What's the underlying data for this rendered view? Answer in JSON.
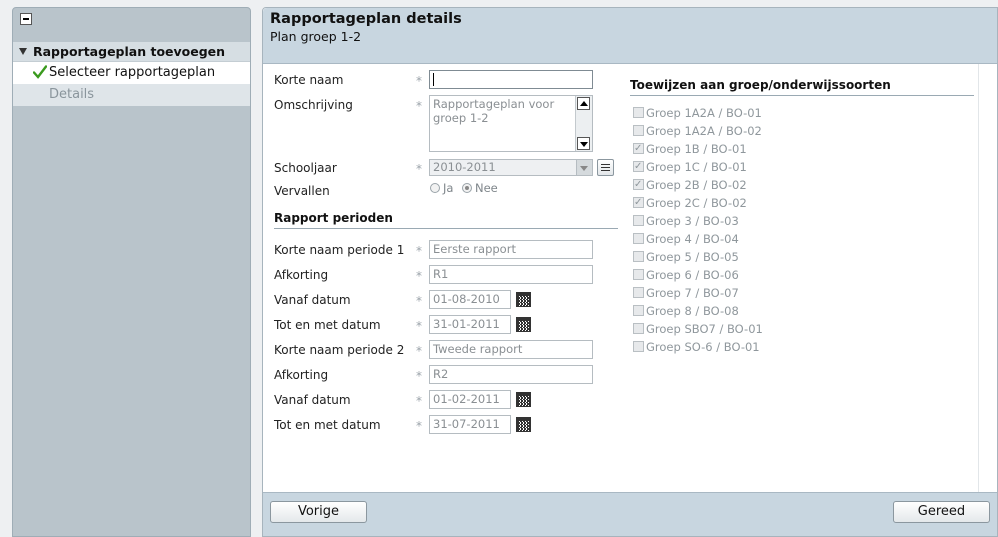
{
  "left_panel": {
    "group_title": "Rapportageplan toevoegen",
    "steps": [
      {
        "label": "Selecteer rapportageplan",
        "state": "done"
      },
      {
        "label": "Details",
        "state": "disabled"
      }
    ]
  },
  "header": {
    "title": "Rapportageplan details",
    "subtitle": "Plan groep 1-2"
  },
  "form": {
    "required_mark": "*",
    "korte_naam": {
      "label": "Korte naam",
      "value": ""
    },
    "omschrijving": {
      "label": "Omschrijving",
      "value": "Rapportageplan voor groep 1-2"
    },
    "schooljaar": {
      "label": "Schooljaar",
      "value": "2010-2011"
    },
    "vervallen": {
      "label": "Vervallen",
      "options": [
        "Ja",
        "Nee"
      ],
      "selected": "Nee"
    }
  },
  "periods": {
    "section_title": "Rapport perioden",
    "items": [
      {
        "name_label": "Korte naam periode 1",
        "name_value": "Eerste rapport",
        "abbr_label": "Afkorting",
        "abbr_value": "R1",
        "from_label": "Vanaf datum",
        "from_value": "01-08-2010",
        "to_label": "Tot en met datum",
        "to_value": "31-01-2011"
      },
      {
        "name_label": "Korte naam periode 2",
        "name_value": "Tweede rapport",
        "abbr_label": "Afkorting",
        "abbr_value": "R2",
        "from_label": "Vanaf datum",
        "from_value": "01-02-2011",
        "to_label": "Tot en met datum",
        "to_value": "31-07-2011"
      }
    ]
  },
  "groups": {
    "section_title": "Toewijzen aan groep/onderwijssoorten",
    "items": [
      {
        "label": "Groep 1A2A / BO-01",
        "checked": false
      },
      {
        "label": "Groep 1A2A / BO-02",
        "checked": false
      },
      {
        "label": "Groep 1B / BO-01",
        "checked": true
      },
      {
        "label": "Groep 1C / BO-01",
        "checked": true
      },
      {
        "label": "Groep 2B / BO-02",
        "checked": true
      },
      {
        "label": "Groep 2C / BO-02",
        "checked": true
      },
      {
        "label": "Groep 3 / BO-03",
        "checked": false
      },
      {
        "label": "Groep 4 / BO-04",
        "checked": false
      },
      {
        "label": "Groep 5 / BO-05",
        "checked": false
      },
      {
        "label": "Groep 6 / BO-06",
        "checked": false
      },
      {
        "label": "Groep 7 / BO-07",
        "checked": false
      },
      {
        "label": "Groep 8 / BO-08",
        "checked": false
      },
      {
        "label": "Groep SBO7 / BO-01",
        "checked": false
      },
      {
        "label": "Groep SO-6 / BO-01",
        "checked": false
      }
    ]
  },
  "footer": {
    "prev_label": "Vorige",
    "done_label": "Gereed"
  },
  "icons": {
    "collapse": "collapse-icon",
    "check": "checkmark-icon",
    "calendar": "calendar-icon",
    "list": "list-icon"
  },
  "colors": {
    "header_bg": "#c8d6e0",
    "sidebar_bg": "#b9c4cb",
    "check_green": "#3a9a1e"
  }
}
